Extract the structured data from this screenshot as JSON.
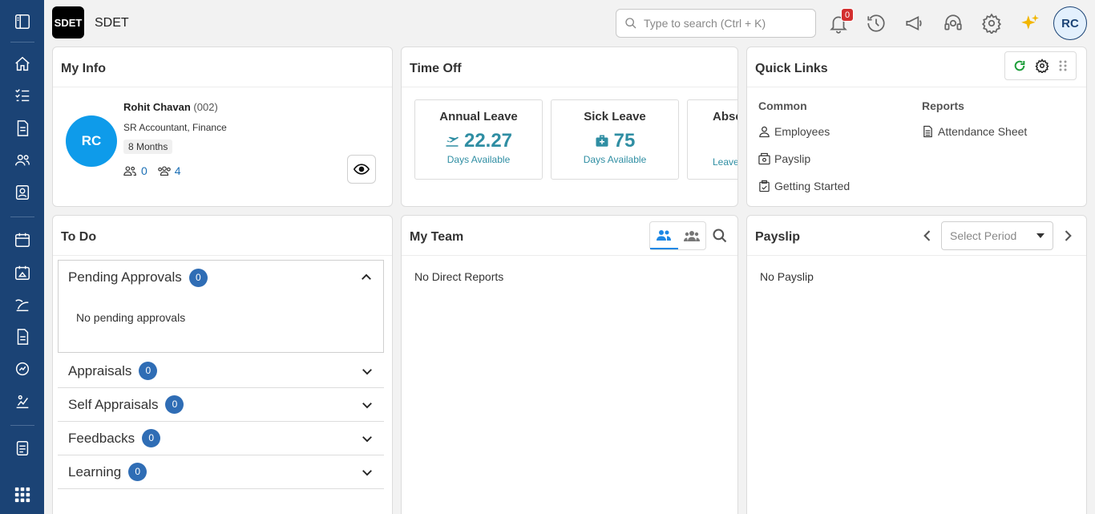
{
  "app": {
    "brand_logo": "SDET",
    "brand_name": "SDET"
  },
  "header": {
    "search_placeholder": "Type to search (Ctrl + K)",
    "notification_count": "0",
    "user_initials": "RC"
  },
  "colors": {
    "sidebar": "#1b4375",
    "accent": "#2f8ea3",
    "badge": "#2f6db5",
    "avatar": "#0e9bea"
  },
  "my_info": {
    "title": "My Info",
    "initials": "RC",
    "name": "Rohit Chavan",
    "code": "(002)",
    "role": "SR Accountant, Finance",
    "tenure": "8 Months",
    "direct_reports": "0",
    "team_count": "4"
  },
  "time_off": {
    "title": "Time Off",
    "items": [
      {
        "name": "Annual Leave",
        "value": "22.27",
        "sub": "Days Available"
      },
      {
        "name": "Sick Leave",
        "value": "75",
        "sub": "Days Available"
      },
      {
        "name": "Abse",
        "value": "",
        "sub": "Leave"
      }
    ]
  },
  "quick_links": {
    "title": "Quick Links",
    "common_heading": "Common",
    "reports_heading": "Reports",
    "common": [
      "Employees",
      "Payslip",
      "Getting Started"
    ],
    "reports": [
      "Attendance Sheet"
    ]
  },
  "todo": {
    "title": "To Do",
    "pending_label": "Pending Approvals",
    "pending_count": "0",
    "pending_empty": "No pending approvals",
    "sections": [
      {
        "label": "Appraisals",
        "count": "0"
      },
      {
        "label": "Self Appraisals",
        "count": "0"
      },
      {
        "label": "Feedbacks",
        "count": "0"
      },
      {
        "label": "Learning",
        "count": "0"
      }
    ]
  },
  "my_team": {
    "title": "My Team",
    "empty": "No Direct Reports"
  },
  "payslip": {
    "title": "Payslip",
    "select_placeholder": "Select Period",
    "empty": "No Payslip"
  }
}
